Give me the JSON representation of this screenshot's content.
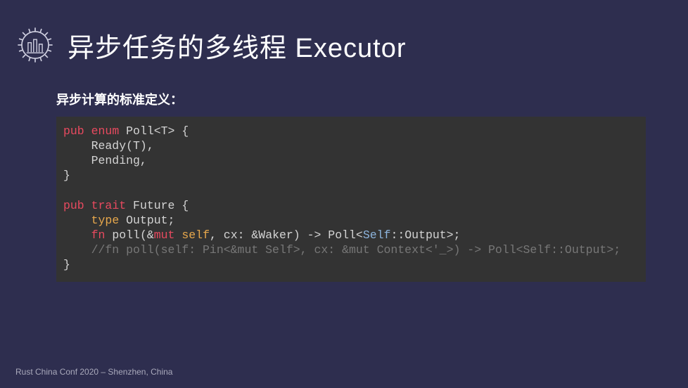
{
  "header": {
    "title": "异步任务的多线程 Executor"
  },
  "subtitle": "异步计算的标准定义：",
  "code": {
    "l1_pub": "pub",
    "l1_enum": "enum",
    "l1_name": "Poll",
    "l1_generic": "<T>",
    "l1_brace": " {",
    "l2": "    Ready(T),",
    "l3": "    Pending,",
    "l4": "}",
    "l5": "",
    "l6_pub": "pub",
    "l6_trait": "trait",
    "l6_name": "Future",
    "l6_brace": " {",
    "l7_type": "type",
    "l7_name": " Output",
    "l7_semi": ";",
    "l8_fn": "fn",
    "l8_name": " poll",
    "l8_paren1": "(&",
    "l8_mut": "mut",
    "l8_self": " self",
    "l8_cx": ", cx: &Waker) -> Poll<",
    "l8_Self": "Self",
    "l8_rest": "::Output>;",
    "l9_comment": "    //fn poll(self: Pin<&mut Self>, cx: &mut Context<'_>) -> Poll<Self::Output>;",
    "l10": "}"
  },
  "footer": "Rust China Conf 2020 – Shenzhen, China"
}
